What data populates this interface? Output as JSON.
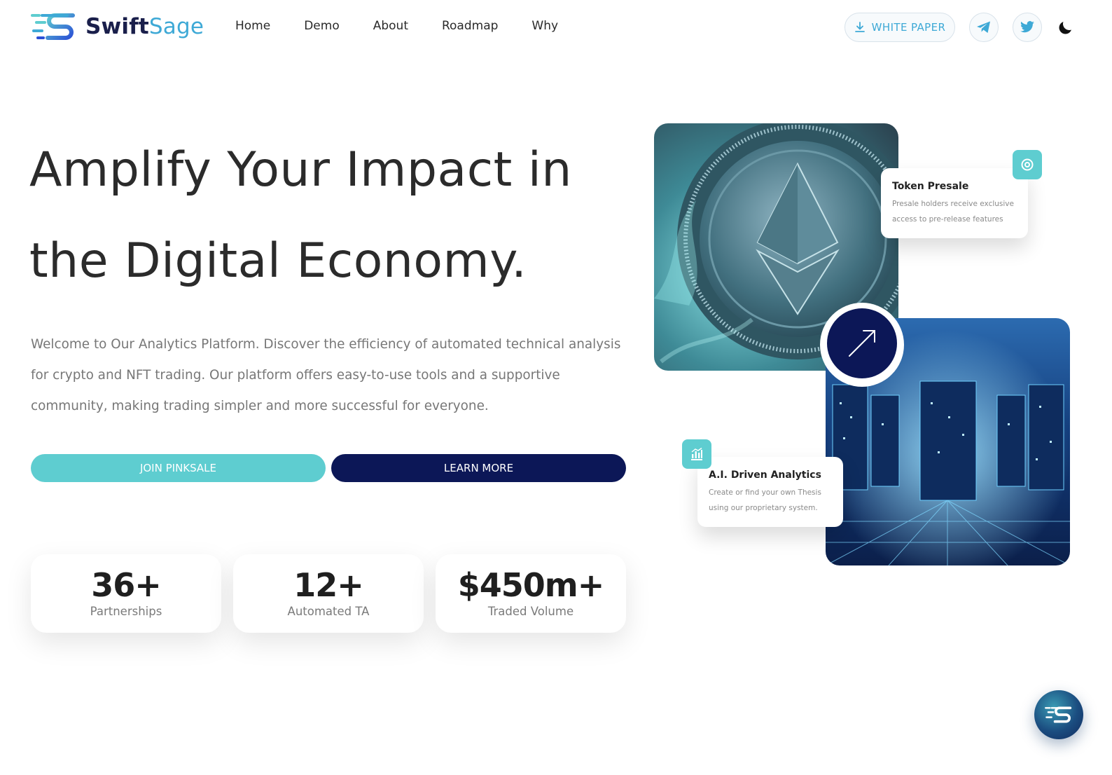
{
  "brand": {
    "name_part1": "Swift",
    "name_part2": "Sage",
    "color_dark": "#1a1f4b",
    "color_accent": "#3ea9d6"
  },
  "nav": {
    "items": [
      {
        "label": "Home"
      },
      {
        "label": "Demo"
      },
      {
        "label": "About"
      },
      {
        "label": "Roadmap"
      },
      {
        "label": "Why"
      }
    ]
  },
  "header": {
    "white_paper_label": "WHITE PAPER",
    "icons": [
      "download-icon",
      "telegram-icon",
      "twitter-icon",
      "moon-icon"
    ]
  },
  "hero": {
    "title_line1": "Amplify Your Impact in",
    "title_line2": "the Digital Economy.",
    "description": "Welcome to Our Analytics Platform. Discover the efficiency of automated technical analysis for crypto and NFT trading. Our platform offers easy-to-use tools and a supportive community, making trading simpler and more successful for everyone.",
    "join_label": "JOIN PINKSALE",
    "learn_label": "LEARN MORE",
    "join_color": "#5ecdd0",
    "learn_color": "#0c1757"
  },
  "stats": [
    {
      "value": "36+",
      "label": "Partnerships"
    },
    {
      "value": "12+",
      "label": "Automated TA"
    },
    {
      "value": "$450m+",
      "label": "Traded Volume"
    }
  ],
  "cards": {
    "presale": {
      "title": "Token Presale",
      "description": "Presale holders receive exclusive access to pre-release features"
    },
    "ai": {
      "title": "A.I. Driven Analytics",
      "description": "Create or find your own Thesis using our proprietary system."
    }
  }
}
